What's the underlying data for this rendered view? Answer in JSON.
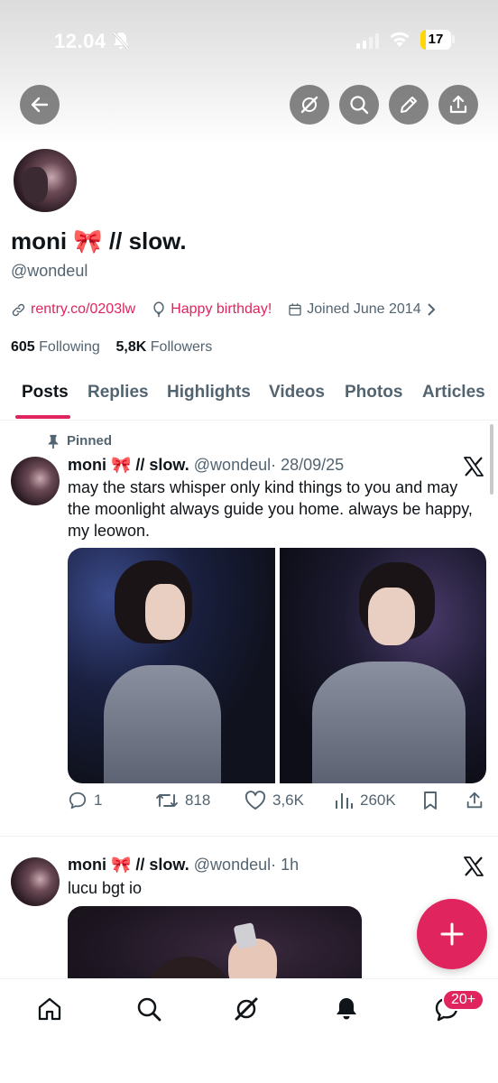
{
  "status_bar": {
    "time": "12.04",
    "battery": "17"
  },
  "header": {
    "back_icon": "arrow-left-icon",
    "buttons": [
      "grok-icon",
      "search-icon",
      "edit-icon",
      "share-icon"
    ]
  },
  "profile": {
    "name": "moni 🎀 // slow.",
    "handle": "@wondeul",
    "link": "rentry.co/0203lw",
    "birthday": "Happy birthday!",
    "joined": "Joined June 2014",
    "following_count": "605",
    "following_label": "Following",
    "followers_count": "5,8K",
    "followers_label": "Followers"
  },
  "tabs": [
    {
      "label": "Posts",
      "active": true
    },
    {
      "label": "Replies"
    },
    {
      "label": "Highlights"
    },
    {
      "label": "Videos"
    },
    {
      "label": "Photos"
    },
    {
      "label": "Articles"
    }
  ],
  "posts": [
    {
      "pinned_label": "Pinned",
      "name": "moni 🎀 // slow.",
      "handle": "@wondeul",
      "time": "· 28/09/25",
      "text": "may the stars whisper only kind things to you and may the moonlight always guide you home. always be happy, my leowon.",
      "replies": "1",
      "reposts": "818",
      "likes": "3,6K",
      "views": "260K"
    },
    {
      "name": "moni 🎀 // slow.",
      "handle": "@wondeul",
      "time": "· 1h",
      "text": "lucu bgt io"
    }
  ],
  "nav": {
    "items": [
      "home-icon",
      "search-icon",
      "grok-icon",
      "notifications-icon",
      "messages-icon"
    ],
    "messages_badge": "20+"
  },
  "colors": {
    "accent": "#e0245e",
    "text": "#0f1419",
    "secondary": "#536471"
  }
}
